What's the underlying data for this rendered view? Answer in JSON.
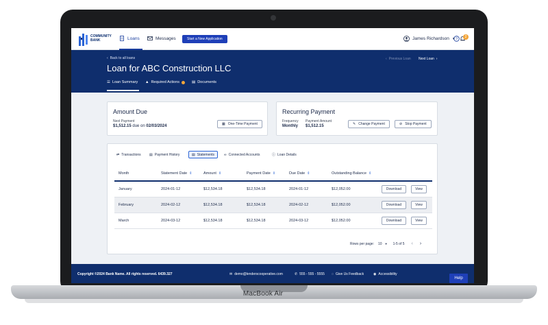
{
  "device": {
    "label": "MacBook Air"
  },
  "nav": {
    "logo_line1": "COMMUNITY",
    "logo_line2": "BANK",
    "loans": "Loans",
    "messages": "Messages",
    "new_application": "Start a New Application",
    "user_name": "James Richardson",
    "notification_count": "2"
  },
  "header": {
    "back_link": "Back to all loans",
    "title": "Loan for ABC Construction LLC",
    "previous": "Previous Loan",
    "next": "Next Loan",
    "tabs": [
      "Loan Summary",
      "Required Actions",
      "Documents"
    ]
  },
  "amount_due": {
    "title": "Amount Due",
    "next_payment_label": "Next Payment",
    "amount": "$1,512.15",
    "due_text": "due on",
    "due_date": "02/03/2024",
    "button": "One-Time Payment"
  },
  "recurring": {
    "title": "Recurring Payment",
    "frequency_label": "Frequency",
    "frequency_value": "Monthly",
    "amount_label": "Payment Amount",
    "amount_value": "$1,512.15",
    "change_button": "Change Payment",
    "stop_button": "Stop Payment"
  },
  "table_tabs": [
    "Transactions",
    "Payment History",
    "Statements",
    "Connected Accounts",
    "Loan Details"
  ],
  "columns": [
    "Month",
    "Statement Date",
    "Amount",
    "Payment Date",
    "Due Date",
    "Outstanding Balance"
  ],
  "rows": [
    {
      "month": "January",
      "statement_date": "2024-01-12",
      "amount": "$12,534.18",
      "payment_amount": "$12,534.18",
      "due_date": "2024-01-12",
      "balance": "$12,052.00"
    },
    {
      "month": "February",
      "statement_date": "2024-02-12",
      "amount": "$12,534.18",
      "payment_amount": "$12,534.18",
      "due_date": "2024-02-12",
      "balance": "$12,052.00"
    },
    {
      "month": "March",
      "statement_date": "2024-03-12",
      "amount": "$12,534.18",
      "payment_amount": "$12,534.18",
      "due_date": "2024-03-12",
      "balance": "$12,052.00"
    }
  ],
  "row_actions": {
    "download": "Download",
    "view": "View"
  },
  "pagination": {
    "rows_label": "Rows per page:",
    "rows_value": "10",
    "range": "1-5 of 5"
  },
  "footer": {
    "copyright": "Copyright ©2024 Bank Name. All rights reserved. 6439.327",
    "email": "demo@lenderscooperative.com",
    "phone": "555 - 555 - 5555",
    "feedback": "Give Us Feedback",
    "accessibility": "Accessibility",
    "help": "Help"
  },
  "colors": {
    "brand_navy": "#0f2e6d",
    "primary_blue": "#1e3fb8",
    "warning": "#f2a53a"
  }
}
